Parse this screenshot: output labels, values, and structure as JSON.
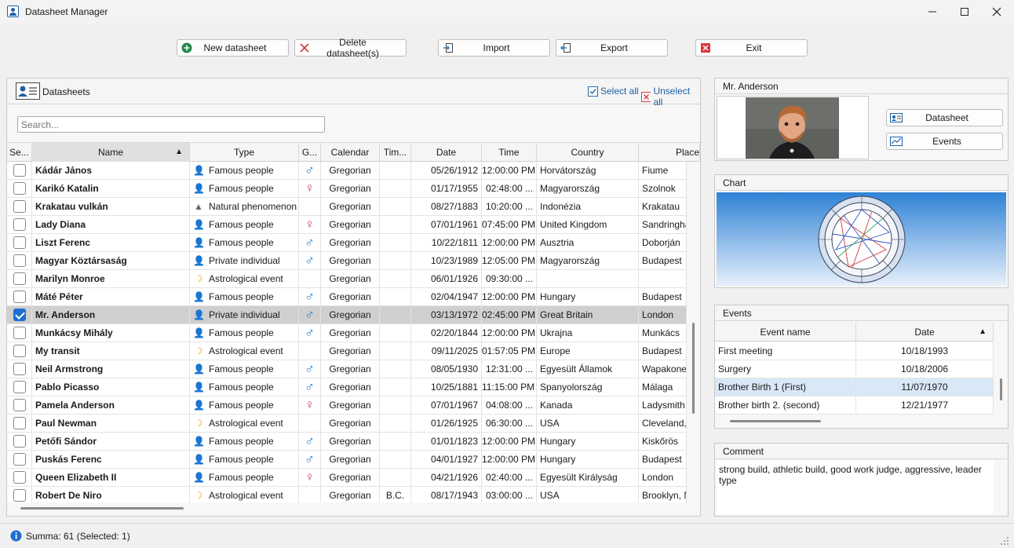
{
  "window": {
    "title": "Datasheet Manager"
  },
  "toolbar": {
    "new": "New datasheet",
    "delete": "Delete datasheet(s)",
    "import": "Import",
    "export": "Export",
    "exit": "Exit"
  },
  "datasheets": {
    "title": "Datasheets",
    "select_all": "Select all",
    "unselect_all": "Unselect all",
    "search_placeholder": "Search..."
  },
  "columns": [
    "Se...",
    "Name",
    "Type",
    "G...",
    "Calendar",
    "Tim...",
    "Date",
    "Time",
    "Country",
    "Place"
  ],
  "rows": [
    {
      "selected": false,
      "name": "Kádár János",
      "type_icon": "person-icon",
      "type": "Famous people",
      "gender": "♂",
      "calendar": "Gregorian",
      "tim": "",
      "date": "05/26/1912",
      "time": "12:00:00 PM",
      "country": "Horvátország",
      "place": "Fiume"
    },
    {
      "selected": false,
      "name": "Karikó Katalin",
      "type_icon": "person-icon",
      "type": "Famous people",
      "gender": "♀",
      "calendar": "Gregorian",
      "tim": "",
      "date": "01/17/1955",
      "time": "02:48:00 ...",
      "country": "Magyarország",
      "place": "Szolnok"
    },
    {
      "selected": false,
      "name": "Krakatau vulkán",
      "type_icon": "mountain-icon",
      "type": "Natural phenomenon",
      "gender": "",
      "calendar": "Gregorian",
      "tim": "",
      "date": "08/27/1883",
      "time": "10:20:00 ...",
      "country": "Indonézia",
      "place": "Krakatau"
    },
    {
      "selected": false,
      "name": "Lady Diana",
      "type_icon": "person-icon",
      "type": "Famous people",
      "gender": "♀",
      "calendar": "Gregorian",
      "tim": "",
      "date": "07/01/1961",
      "time": "07:45:00 PM",
      "country": "United Kingdom",
      "place": "Sandringham"
    },
    {
      "selected": false,
      "name": "Liszt Ferenc",
      "type_icon": "person-icon",
      "type": "Famous people",
      "gender": "♂",
      "calendar": "Gregorian",
      "tim": "",
      "date": "10/22/1811",
      "time": "12:00:00 PM",
      "country": "Ausztria",
      "place": "Doborján"
    },
    {
      "selected": false,
      "name": "Magyar Köztársaság",
      "type_icon": "private-person-icon",
      "type": "Private individual",
      "gender": "♂",
      "calendar": "Gregorian",
      "tim": "",
      "date": "10/23/1989",
      "time": "12:05:00 PM",
      "country": "Magyarország",
      "place": "Budapest"
    },
    {
      "selected": false,
      "name": "Marilyn Monroe",
      "type_icon": "moon-icon",
      "type": "Astrological event",
      "gender": "",
      "calendar": "Gregorian",
      "tim": "",
      "date": "06/01/1926",
      "time": "09:30:00 ...",
      "country": "",
      "place": ""
    },
    {
      "selected": false,
      "name": "Máté Péter",
      "type_icon": "person-icon",
      "type": "Famous people",
      "gender": "♂",
      "calendar": "Gregorian",
      "tim": "",
      "date": "02/04/1947",
      "time": "12:00:00 PM",
      "country": "Hungary",
      "place": "Budapest"
    },
    {
      "selected": true,
      "name": "Mr. Anderson",
      "type_icon": "private-person-icon",
      "type": "Private individual",
      "gender": "♂",
      "calendar": "Gregorian",
      "tim": "",
      "date": "03/13/1972",
      "time": "02:45:00 PM",
      "country": "Great Britain",
      "place": "London"
    },
    {
      "selected": false,
      "name": "Munkácsy Mihály",
      "type_icon": "person-icon",
      "type": "Famous people",
      "gender": "♂",
      "calendar": "Gregorian",
      "tim": "",
      "date": "02/20/1844",
      "time": "12:00:00 PM",
      "country": "Ukrajna",
      "place": "Munkács"
    },
    {
      "selected": false,
      "name": "My transit",
      "type_icon": "moon-icon",
      "type": "Astrological event",
      "gender": "",
      "calendar": "Gregorian",
      "tim": "",
      "date": "09/11/2025",
      "time": "01:57:05 PM",
      "country": "Europe",
      "place": "Budapest"
    },
    {
      "selected": false,
      "name": "Neil Armstrong",
      "type_icon": "person-icon",
      "type": "Famous people",
      "gender": "♂",
      "calendar": "Gregorian",
      "tim": "",
      "date": "08/05/1930",
      "time": "12:31:00 ...",
      "country": "Egyesült Államok",
      "place": "Wapakoneta"
    },
    {
      "selected": false,
      "name": "Pablo Picasso",
      "type_icon": "person-icon",
      "type": "Famous people",
      "gender": "♂",
      "calendar": "Gregorian",
      "tim": "",
      "date": "10/25/1881",
      "time": "11:15:00 PM",
      "country": "Spanyolország",
      "place": "Málaga"
    },
    {
      "selected": false,
      "name": "Pamela Anderson",
      "type_icon": "person-icon",
      "type": "Famous people",
      "gender": "♀",
      "calendar": "Gregorian",
      "tim": "",
      "date": "07/01/1967",
      "time": "04:08:00 ...",
      "country": "Kanada",
      "place": "Ladysmith"
    },
    {
      "selected": false,
      "name": "Paul Newman",
      "type_icon": "moon-icon",
      "type": "Astrological event",
      "gender": "",
      "calendar": "Gregorian",
      "tim": "",
      "date": "01/26/1925",
      "time": "06:30:00 ...",
      "country": "USA",
      "place": "Cleveland, O"
    },
    {
      "selected": false,
      "name": "Petőfi Sándor",
      "type_icon": "person-icon",
      "type": "Famous people",
      "gender": "♂",
      "calendar": "Gregorian",
      "tim": "",
      "date": "01/01/1823",
      "time": "12:00:00 PM",
      "country": "Hungary",
      "place": "Kiskőrös"
    },
    {
      "selected": false,
      "name": "Puskás Ferenc",
      "type_icon": "person-icon",
      "type": "Famous people",
      "gender": "♂",
      "calendar": "Gregorian",
      "tim": "",
      "date": "04/01/1927",
      "time": "12:00:00 PM",
      "country": "Hungary",
      "place": "Budapest"
    },
    {
      "selected": false,
      "name": "Queen Elizabeth II",
      "type_icon": "person-icon",
      "type": "Famous people",
      "gender": "♀",
      "calendar": "Gregorian",
      "tim": "",
      "date": "04/21/1926",
      "time": "02:40:00 ...",
      "country": "Egyesült Királyság",
      "place": "London"
    },
    {
      "selected": false,
      "name": "Robert De Niro",
      "type_icon": "moon-icon",
      "type": "Astrological event",
      "gender": "",
      "calendar": "Gregorian",
      "tim": "B.C.",
      "date": "08/17/1943",
      "time": "03:00:00 ...",
      "country": "USA",
      "place": "Brooklyn, NY"
    }
  ],
  "detail": {
    "title": "Mr. Anderson",
    "datasheet_button": "Datasheet",
    "events_button": "Events"
  },
  "chart": {
    "title": "Chart"
  },
  "events": {
    "title": "Events",
    "columns": [
      "Event name",
      "Date"
    ],
    "rows": [
      {
        "name": "First meeting",
        "date": "10/18/1993",
        "highlight": false
      },
      {
        "name": "Surgery",
        "date": "10/18/2006",
        "highlight": false
      },
      {
        "name": "Brother Birth 1 (First)",
        "date": "11/07/1970",
        "highlight": true
      },
      {
        "name": "Brother birth 2. (second)",
        "date": "12/21/1977",
        "highlight": false
      }
    ]
  },
  "comment": {
    "title": "Comment",
    "text": "strong build, athletic build, good work judge, aggressive, leader type"
  },
  "status": {
    "text": "Summa: 61 (Selected: 1)"
  },
  "colors": {
    "accent": "#1c6ed4",
    "male": "#2a7fc9",
    "female": "#d94660",
    "person": "#e8703a",
    "moon": "#f0a020",
    "exit": "#d9363e",
    "add": "#1f8a4c"
  }
}
